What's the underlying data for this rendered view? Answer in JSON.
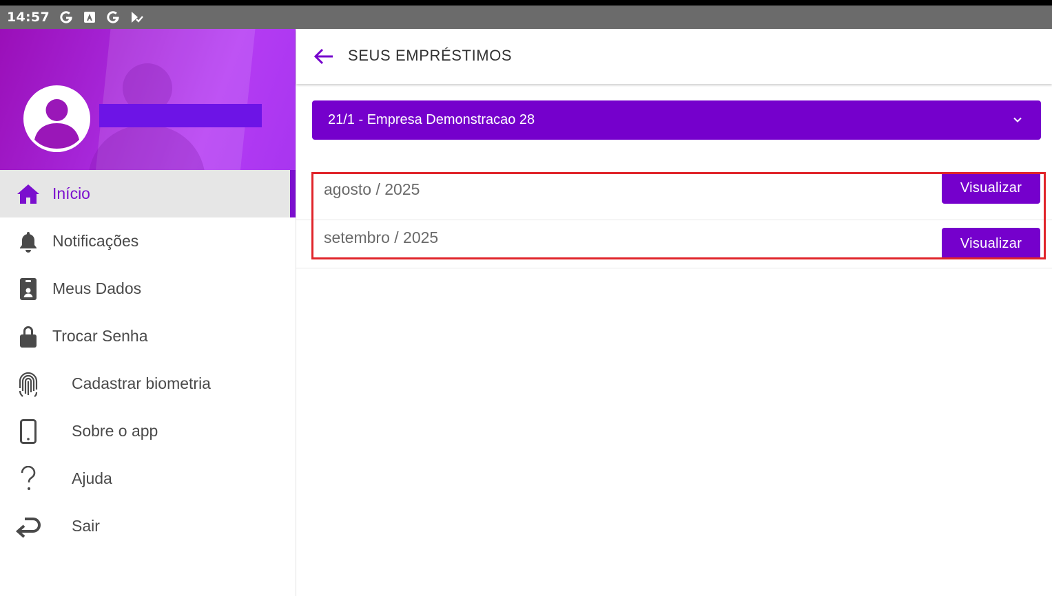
{
  "status_bar": {
    "time": "14:57",
    "icons": [
      "google-g-icon",
      "app-a-icon",
      "google-g-icon",
      "play-check-icon"
    ]
  },
  "sidebar": {
    "user_name": "",
    "items": [
      {
        "label": "Início",
        "icon": "home-icon",
        "active": true
      },
      {
        "label": "Notificações",
        "icon": "bell-icon",
        "active": false
      },
      {
        "label": "Meus Dados",
        "icon": "id-badge-icon",
        "active": false
      },
      {
        "label": "Trocar Senha",
        "icon": "lock-icon",
        "active": false
      },
      {
        "label": "Cadastrar biometria",
        "icon": "fingerprint-icon",
        "active": false
      },
      {
        "label": "Sobre o app",
        "icon": "phone-icon",
        "active": false
      },
      {
        "label": "Ajuda",
        "icon": "question-icon",
        "active": false
      },
      {
        "label": "Sair",
        "icon": "exit-arrow-icon",
        "active": false
      }
    ]
  },
  "header": {
    "title": "SEUS EMPRÉSTIMOS",
    "back_icon": "arrow-left-icon"
  },
  "company_select": {
    "selected": "21/1 - Empresa Demonstracao 28"
  },
  "loans": [
    {
      "period": "agosto / 2025",
      "action": "Visualizar"
    },
    {
      "period": "setembro / 2025",
      "action": "Visualizar"
    }
  ],
  "colors": {
    "accent": "#7500cc",
    "status_bar": "#6b6b6b",
    "highlight": "#e0242a"
  }
}
